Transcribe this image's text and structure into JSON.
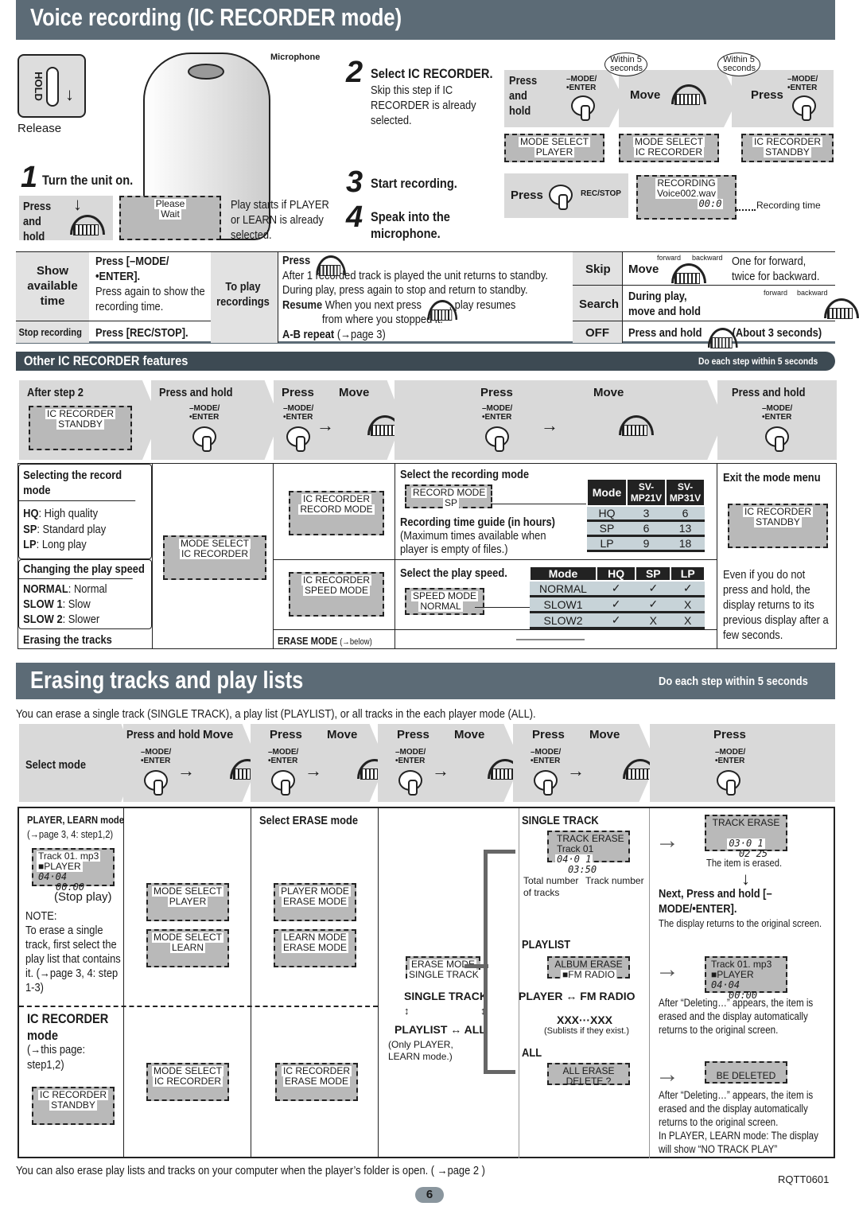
{
  "header": {
    "title": "Voice recording (IC RECORDER mode)"
  },
  "top": {
    "hold_label": "HOLD",
    "release": "Release",
    "microphone": "Microphone",
    "step1": {
      "num": "1",
      "title": "Turn the unit on.",
      "press_and_hold": "Press and hold",
      "lcd": [
        "Please",
        "Wait"
      ],
      "note": "Play starts if PLAYER or LEARN is already selected."
    },
    "step2": {
      "num": "2",
      "title": "Select IC RECORDER.",
      "note": "Skip this step if IC RECORDER is already selected."
    },
    "step3": {
      "num": "3",
      "title": "Start recording."
    },
    "step4": {
      "num": "4",
      "title": "Speak into the microphone."
    },
    "flow": {
      "press_and_hold": "Press and hold",
      "move": "Move",
      "press": "Press",
      "within": "Within 5 seconds",
      "mode_key": "–MODE/ •ENTER",
      "lcd1": [
        "MODE SELECT",
        "PLAYER"
      ],
      "lcd2": [
        "MODE SELECT",
        "IC RECORDER"
      ],
      "lcd3": [
        "IC RECORDER",
        "STANDBY"
      ],
      "rec_press": "Press",
      "rec_key": "REC/STOP",
      "lcd4": [
        "RECORDING",
        "Voice002.wav",
        "00:0"
      ],
      "rec_time": "Recording time"
    }
  },
  "quick": {
    "show_time": {
      "label": "Show available time",
      "text1": "Press [–MODE/•ENTER].",
      "text2": "Press again to show the recording time."
    },
    "stop": {
      "label": "Stop recording",
      "text": "Press [REC/STOP]."
    },
    "play": {
      "label": "To play recordings",
      "press": "Press",
      "l1": "After 1 recorded track is played the unit returns to standby.",
      "l2": "During play, press again to stop and return to standby.",
      "resume": "Resume",
      "l3": "When you next press",
      "l3b": ", play resumes",
      "l4": "from where you stopped it.",
      "ab": "A-B repeat",
      "ab_ref": "(→page 3)"
    },
    "skip": {
      "label": "Skip",
      "move": "Move",
      "fwd": "forward",
      "bwd": "backward",
      "text": "One for forward, twice for backward."
    },
    "search": {
      "label": "Search",
      "text": "During play, move and hold",
      "fwd": "forward",
      "bwd": "backward"
    },
    "off": {
      "label": "OFF",
      "text": "Press and hold",
      "text2": "(About 3 seconds)"
    }
  },
  "features": {
    "title": "Other IC RECORDER features",
    "note": "Do each step within 5 seconds",
    "strip": {
      "after": "After step 2",
      "lcd": [
        "IC RECORDER",
        "STANDBY"
      ],
      "press_and_hold": "Press and hold",
      "press": "Press",
      "move": "Move",
      "mode_key": "–MODE/ •ENTER"
    },
    "record_mode": {
      "title": "Selecting the record mode",
      "hq": "HQ",
      "hq_t": ": High quality",
      "sp": "SP",
      "sp_t": ": Standard play",
      "lp": "LP",
      "lp_t": ": Long play"
    },
    "play_speed": {
      "title": "Changing the play speed",
      "normal": "NORMAL",
      "normal_t": ": Normal",
      "slow1": "SLOW 1",
      "slow1_t": ":  Slow",
      "slow2": "SLOW 2",
      "slow2_t": ":  Slower"
    },
    "erase": {
      "title": "Erasing the tracks",
      "mode": "ERASE MODE",
      "ref": "(→below)"
    },
    "lcd_mode_select": [
      "MODE SELECT",
      "IC RECORDER"
    ],
    "lcd_record_mode": [
      "IC RECORDER",
      "RECORD MODE"
    ],
    "lcd_speed_mode": [
      "IC RECORDER",
      "SPEED MODE"
    ],
    "select_rec": "Select the recording mode",
    "lcd_rec_sp": [
      "RECORD MODE",
      "SP"
    ],
    "guide_title": "Recording time guide (in hours)",
    "guide_note": "(Maximum times available when player is empty of files.)",
    "rec_table": {
      "headers": [
        "Mode",
        "SV-MP21V",
        "SV-MP31V"
      ],
      "rows": [
        [
          "HQ",
          "3",
          "6"
        ],
        [
          "SP",
          "6",
          "13"
        ],
        [
          "LP",
          "9",
          "18"
        ]
      ]
    },
    "select_speed": "Select the play speed.",
    "lcd_speed": [
      "SPEED MODE",
      "NORMAL"
    ],
    "speed_table": {
      "headers": [
        "Mode",
        "HQ",
        "SP",
        "LP"
      ],
      "rows": [
        [
          "NORMAL",
          "✓",
          "✓",
          "✓"
        ],
        [
          "SLOW1",
          "✓",
          "✓",
          "X"
        ],
        [
          "SLOW2",
          "✓",
          "X",
          "X"
        ]
      ]
    },
    "exit": {
      "title": "Exit the mode menu",
      "lcd": [
        "IC RECORDER",
        "STANDBY"
      ],
      "note": "Even if you do not press and hold, the display returns to its previous display after a few seconds."
    }
  },
  "erase": {
    "title": "Erasing tracks and play lists",
    "note": "Do each step within 5 seconds",
    "intro": "You can erase a single track (SINGLE TRACK), a play list (PLAYLIST), or all tracks in the each player mode (ALL).",
    "strip": {
      "select_mode": "Select mode",
      "press_and_hold": "Press and hold",
      "press": "Press",
      "move": "Move",
      "mode_key": "–MODE/ •ENTER"
    },
    "player_learn": {
      "title": "PLAYER, LEARN  mode",
      "ref": "(→page 3, 4: step1,2)",
      "lcd": [
        "Track 01. mp3",
        "■PLAYER",
        "04·04",
        "00:00"
      ],
      "stop": "(Stop play)",
      "note_label": "NOTE:",
      "note": "To erase a single track, first select the play list that contains it. (→page 3, 4: step 1-3)"
    },
    "ic": {
      "title": "IC RECORDER mode",
      "ref": "(→this page: step1,2)",
      "lcd": [
        "IC RECORDER",
        "STANDBY"
      ]
    },
    "lcd_ms_player": [
      "MODE  SELECT",
      "PLAYER"
    ],
    "lcd_ms_learn": [
      "MODE  SELECT",
      "LEARN"
    ],
    "lcd_ms_ic": [
      "MODE  SELECT",
      "IC RECORDER"
    ],
    "select_erase": "Select ERASE mode",
    "lcd_pm": [
      "PLAYER MODE",
      "ERASE MODE"
    ],
    "lcd_lm": [
      "LEARN MODE",
      "ERASE MODE"
    ],
    "lcd_icm": [
      "IC RECORDER",
      "ERASE  MODE"
    ],
    "lcd_em": [
      "ERASE MODE",
      "SINGLE TRACK"
    ],
    "cycle": {
      "single": "SINGLE TRACK",
      "playlist": "PLAYLIST",
      "all": "ALL",
      "note": "(Only PLAYER, LEARN mode.)"
    },
    "single": {
      "title": "SINGLE TRACK",
      "lcd": [
        "TRACK ERASE",
        "Track  01",
        "04·0 1",
        "03:50"
      ],
      "total": "Total number of tracks",
      "track": "Track number"
    },
    "playlist": {
      "title": "PLAYLIST",
      "lcd": [
        "ALBUM ERASE",
        "■FM RADIO"
      ],
      "player": "PLAYER",
      "fm": "FM RADIO",
      "xxx": "XXX···XXX",
      "sub": "(Sublists if they exist.)"
    },
    "all": {
      "title": "ALL",
      "lcd": [
        "ALL ERASE",
        "DELETE   ?"
      ]
    },
    "res_single": {
      "lcd": [
        "TRACK ERASE",
        "03·0 1",
        "02 25"
      ],
      "erased": "The item is erased.",
      "next": "Next, Press and hold [–MODE/•ENTER].",
      "returns": "The display returns to the original screen."
    },
    "res_playlist": {
      "lcd": [
        "Track 01. mp3",
        "■PLAYER",
        "04·04",
        "00:00"
      ],
      "text": "After “Deleting…” appears, the item is erased and the display automatically returns to the original screen."
    },
    "res_all": {
      "lcd": [
        "BE DELETED"
      ],
      "text": "After “Deleting…” appears, the item is erased and the display automatically returns to the original screen.",
      "text2": "In PLAYER, LEARN mode: The display will show “NO TRACK PLAY”"
    }
  },
  "footer": {
    "text": "You can also erase play lists and tracks on your computer when the player’s folder is open. ( →page 2 )",
    "code": "RQTT0601",
    "page": "6"
  },
  "colors": {
    "header": "#5c6b76",
    "lcd": "#b9b9b9",
    "panel": "#d9d9d9"
  }
}
